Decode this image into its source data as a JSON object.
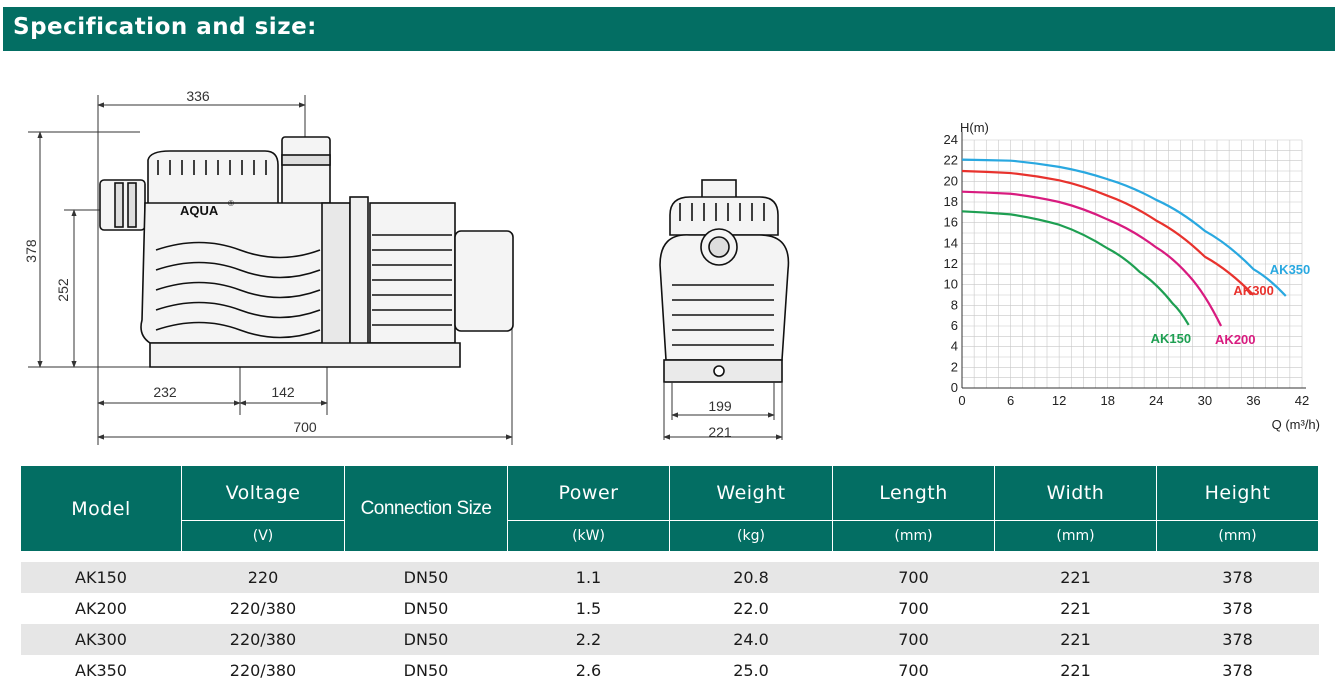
{
  "header": {
    "title": "Specification and size:"
  },
  "drawing": {
    "brand": "AQUA",
    "brand_mark": "®",
    "side_dims": {
      "top_width": "336",
      "total_height": "378",
      "inlet_height": "252",
      "left_base": "232",
      "base_spacing": "142",
      "total_length": "700"
    },
    "front_dims": {
      "base_width": "199",
      "total_width": "221"
    }
  },
  "chart_data": {
    "type": "line",
    "title": "",
    "ylabel": "H(m)",
    "xlabel": "Q (m³/h)",
    "xlim": [
      0,
      42
    ],
    "ylim": [
      0,
      24
    ],
    "xticks": [
      0,
      6,
      12,
      18,
      24,
      30,
      36,
      42
    ],
    "yticks": [
      0,
      2,
      4,
      6,
      8,
      10,
      12,
      14,
      16,
      18,
      20,
      22,
      24
    ],
    "grid": true,
    "series": [
      {
        "name": "AK350",
        "color": "#29a8e0",
        "x": [
          0,
          6,
          12,
          18,
          24,
          30,
          36,
          40
        ],
        "y": [
          22.1,
          22.0,
          21.4,
          20.2,
          18.2,
          15.2,
          11.5,
          8.9
        ]
      },
      {
        "name": "AK300",
        "color": "#e8322d",
        "x": [
          0,
          6,
          12,
          18,
          24,
          30,
          36
        ],
        "y": [
          21.0,
          20.8,
          20.1,
          18.6,
          16.2,
          12.7,
          9.0
        ]
      },
      {
        "name": "AK200",
        "color": "#d81b7f",
        "x": [
          0,
          6,
          12,
          18,
          24,
          28,
          32
        ],
        "y": [
          19.0,
          18.8,
          18.0,
          16.3,
          13.6,
          10.9,
          6.0
        ]
      },
      {
        "name": "AK150",
        "color": "#1e9f52",
        "x": [
          0,
          6,
          12,
          18,
          22,
          26,
          28
        ],
        "y": [
          17.1,
          16.8,
          15.8,
          13.5,
          11.2,
          8.2,
          6.1
        ]
      }
    ]
  },
  "table": {
    "headers": [
      {
        "label": "Model",
        "unit": ""
      },
      {
        "label": "Voltage",
        "unit": "(V)"
      },
      {
        "label": "Connection Size",
        "unit": ""
      },
      {
        "label": "Power",
        "unit": "(kW)"
      },
      {
        "label": "Weight",
        "unit": "(kg)"
      },
      {
        "label": "Length",
        "unit": "(mm)"
      },
      {
        "label": "Width",
        "unit": "(mm)"
      },
      {
        "label": "Height",
        "unit": "(mm)"
      }
    ],
    "rows": [
      [
        "AK150",
        "220",
        "DN50",
        "1.1",
        "20.8",
        "700",
        "221",
        "378"
      ],
      [
        "AK200",
        "220/380",
        "DN50",
        "1.5",
        "22.0",
        "700",
        "221",
        "378"
      ],
      [
        "AK300",
        "220/380",
        "DN50",
        "2.2",
        "24.0",
        "700",
        "221",
        "378"
      ],
      [
        "AK350",
        "220/380",
        "DN50",
        "2.6",
        "25.0",
        "700",
        "221",
        "378"
      ]
    ]
  }
}
